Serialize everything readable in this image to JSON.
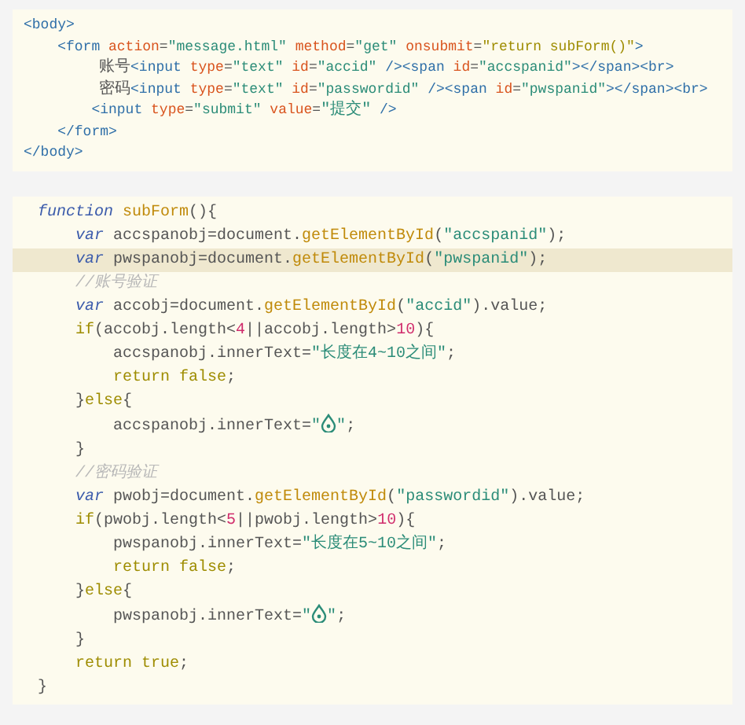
{
  "blocks": [
    {
      "lines": [
        {
          "tokens": [
            {
              "kind": "tag",
              "text": "<body>"
            }
          ]
        },
        {
          "tokens": [
            {
              "kind": "tag",
              "text": "    <form"
            },
            {
              "kind": "attr",
              "text": " action"
            },
            {
              "kind": "plain",
              "text": "="
            },
            {
              "kind": "str",
              "text": "\"message.html\""
            },
            {
              "kind": "attr",
              "text": " method"
            },
            {
              "kind": "plain",
              "text": "="
            },
            {
              "kind": "str",
              "text": "\"get\""
            },
            {
              "kind": "attr",
              "text": " onsubmit"
            },
            {
              "kind": "plain",
              "text": "="
            },
            {
              "kind": "ctl",
              "text": "\"return subForm()\""
            },
            {
              "kind": "tag",
              "text": ">"
            }
          ]
        },
        {
          "tokens": [
            {
              "kind": "plain",
              "text": "        账号"
            },
            {
              "kind": "tag",
              "text": "<input"
            },
            {
              "kind": "attr",
              "text": " type"
            },
            {
              "kind": "plain",
              "text": "="
            },
            {
              "kind": "str",
              "text": "\"text\""
            },
            {
              "kind": "attr",
              "text": " id"
            },
            {
              "kind": "plain",
              "text": "="
            },
            {
              "kind": "str",
              "text": "\"accid\""
            },
            {
              "kind": "tag",
              "text": " /><span"
            },
            {
              "kind": "attr",
              "text": " id"
            },
            {
              "kind": "plain",
              "text": "="
            },
            {
              "kind": "str",
              "text": "\"accspanid\""
            },
            {
              "kind": "tag",
              "text": "></span><br>"
            }
          ]
        },
        {
          "tokens": [
            {
              "kind": "plain",
              "text": "        密码"
            },
            {
              "kind": "tag",
              "text": "<input"
            },
            {
              "kind": "attr",
              "text": " type"
            },
            {
              "kind": "plain",
              "text": "="
            },
            {
              "kind": "str",
              "text": "\"text\""
            },
            {
              "kind": "attr",
              "text": " id"
            },
            {
              "kind": "plain",
              "text": "="
            },
            {
              "kind": "str",
              "text": "\"passwordid\""
            },
            {
              "kind": "tag",
              "text": " /><span"
            },
            {
              "kind": "attr",
              "text": " id"
            },
            {
              "kind": "plain",
              "text": "="
            },
            {
              "kind": "str",
              "text": "\"pwspanid\""
            },
            {
              "kind": "tag",
              "text": "></span><br>"
            }
          ]
        },
        {
          "tokens": [
            {
              "kind": "tag",
              "text": "        <input"
            },
            {
              "kind": "attr",
              "text": " type"
            },
            {
              "kind": "plain",
              "text": "="
            },
            {
              "kind": "str",
              "text": "\"submit\""
            },
            {
              "kind": "attr",
              "text": " value"
            },
            {
              "kind": "plain",
              "text": "="
            },
            {
              "kind": "str",
              "text": "\"提交\""
            },
            {
              "kind": "tag",
              "text": " />"
            }
          ]
        },
        {
          "tokens": [
            {
              "kind": "tag",
              "text": "    </form>"
            }
          ]
        },
        {
          "tokens": [
            {
              "kind": "tag",
              "text": "</body>"
            }
          ]
        }
      ]
    },
    {
      "lines": [
        {
          "highlighted": false,
          "tokens": [
            {
              "kind": "kw",
              "text": "function"
            },
            {
              "kind": "fn",
              "text": " subForm"
            },
            {
              "kind": "plain",
              "text": "(){"
            }
          ]
        },
        {
          "highlighted": false,
          "tokens": [
            {
              "kind": "kw",
              "text": "    var"
            },
            {
              "kind": "plain",
              "text": " accspanobj=document."
            },
            {
              "kind": "fn",
              "text": "getElementById"
            },
            {
              "kind": "plain",
              "text": "("
            },
            {
              "kind": "str",
              "text": "\"accspanid\""
            },
            {
              "kind": "plain",
              "text": ");"
            }
          ]
        },
        {
          "highlighted": true,
          "tokens": [
            {
              "kind": "kw",
              "text": "    var"
            },
            {
              "kind": "plain",
              "text": " pwspanobj=document."
            },
            {
              "kind": "fn",
              "text": "getElementById"
            },
            {
              "kind": "plain",
              "text": "("
            },
            {
              "kind": "str",
              "text": "\"pwspanid\""
            },
            {
              "kind": "plain",
              "text": ");"
            }
          ]
        },
        {
          "highlighted": false,
          "tokens": [
            {
              "kind": "cmt",
              "text": "    //账号验证"
            }
          ]
        },
        {
          "highlighted": false,
          "tokens": [
            {
              "kind": "kw",
              "text": "    var"
            },
            {
              "kind": "plain",
              "text": " accobj=document."
            },
            {
              "kind": "fn",
              "text": "getElementById"
            },
            {
              "kind": "plain",
              "text": "("
            },
            {
              "kind": "str",
              "text": "\"accid\""
            },
            {
              "kind": "plain",
              "text": ").value;"
            }
          ]
        },
        {
          "highlighted": false,
          "tokens": [
            {
              "kind": "ctl",
              "text": "    if"
            },
            {
              "kind": "plain",
              "text": "(accobj.length<"
            },
            {
              "kind": "num",
              "text": "4"
            },
            {
              "kind": "plain",
              "text": "||accobj.length>"
            },
            {
              "kind": "num",
              "text": "10"
            },
            {
              "kind": "plain",
              "text": "){"
            }
          ]
        },
        {
          "highlighted": false,
          "tokens": [
            {
              "kind": "plain",
              "text": "        accspanobj.innerText="
            },
            {
              "kind": "str",
              "text": "\"长度在4~10之间\""
            },
            {
              "kind": "plain",
              "text": ";"
            }
          ]
        },
        {
          "highlighted": false,
          "tokens": [
            {
              "kind": "ctl",
              "text": "        return false"
            },
            {
              "kind": "plain",
              "text": ";"
            }
          ]
        },
        {
          "highlighted": false,
          "tokens": [
            {
              "kind": "plain",
              "text": "    }"
            },
            {
              "kind": "ctl",
              "text": "else"
            },
            {
              "kind": "plain",
              "text": "{"
            }
          ]
        },
        {
          "highlighted": false,
          "tokens": [
            {
              "kind": "plain",
              "text": "        accspanobj.innerText="
            },
            {
              "kind": "str",
              "text": "\""
            },
            {
              "kind": "icon"
            },
            {
              "kind": "str",
              "text": "\""
            },
            {
              "kind": "plain",
              "text": ";"
            }
          ]
        },
        {
          "highlighted": false,
          "tokens": [
            {
              "kind": "plain",
              "text": "    }"
            }
          ]
        },
        {
          "highlighted": false,
          "tokens": [
            {
              "kind": "cmt",
              "text": "    //密码验证"
            }
          ]
        },
        {
          "highlighted": false,
          "tokens": [
            {
              "kind": "kw",
              "text": "    var"
            },
            {
              "kind": "plain",
              "text": " pwobj=document."
            },
            {
              "kind": "fn",
              "text": "getElementById"
            },
            {
              "kind": "plain",
              "text": "("
            },
            {
              "kind": "str",
              "text": "\"passwordid\""
            },
            {
              "kind": "plain",
              "text": ").value;"
            }
          ]
        },
        {
          "highlighted": false,
          "tokens": [
            {
              "kind": "ctl",
              "text": "    if"
            },
            {
              "kind": "plain",
              "text": "(pwobj.length<"
            },
            {
              "kind": "num",
              "text": "5"
            },
            {
              "kind": "plain",
              "text": "||pwobj.length>"
            },
            {
              "kind": "num",
              "text": "10"
            },
            {
              "kind": "plain",
              "text": "){"
            }
          ]
        },
        {
          "highlighted": false,
          "tokens": [
            {
              "kind": "plain",
              "text": "        pwspanobj.innerText="
            },
            {
              "kind": "str",
              "text": "\"长度在5~10之间\""
            },
            {
              "kind": "plain",
              "text": ";"
            }
          ]
        },
        {
          "highlighted": false,
          "tokens": [
            {
              "kind": "ctl",
              "text": "        return false"
            },
            {
              "kind": "plain",
              "text": ";"
            }
          ]
        },
        {
          "highlighted": false,
          "tokens": [
            {
              "kind": "plain",
              "text": "    }"
            },
            {
              "kind": "ctl",
              "text": "else"
            },
            {
              "kind": "plain",
              "text": "{"
            }
          ]
        },
        {
          "highlighted": false,
          "tokens": [
            {
              "kind": "plain",
              "text": "        pwspanobj.innerText="
            },
            {
              "kind": "str",
              "text": "\""
            },
            {
              "kind": "icon"
            },
            {
              "kind": "str",
              "text": "\""
            },
            {
              "kind": "plain",
              "text": ";"
            }
          ]
        },
        {
          "highlighted": false,
          "tokens": [
            {
              "kind": "plain",
              "text": "    }"
            }
          ]
        },
        {
          "highlighted": false,
          "tokens": [
            {
              "kind": "ctl",
              "text": "    return true"
            },
            {
              "kind": "plain",
              "text": ";"
            }
          ]
        },
        {
          "highlighted": false,
          "tokens": [
            {
              "kind": "plain",
              "text": "}"
            }
          ]
        }
      ]
    }
  ]
}
